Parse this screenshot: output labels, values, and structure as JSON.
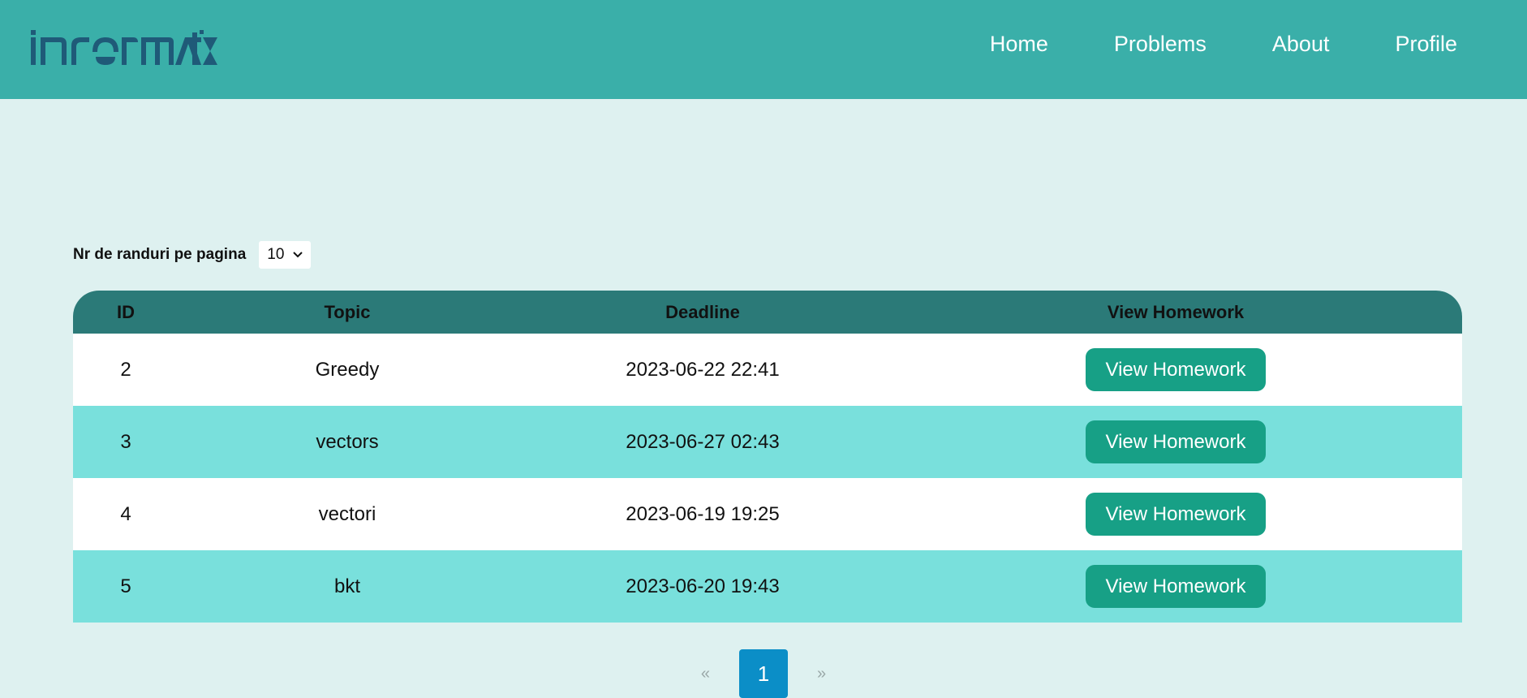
{
  "brand": {
    "logo_text": "informatix",
    "logo_color": "#1f5a78"
  },
  "nav": {
    "items": [
      {
        "label": "Home"
      },
      {
        "label": "Problems"
      },
      {
        "label": "About"
      },
      {
        "label": "Profile"
      }
    ]
  },
  "controls": {
    "rows_label": "Nr de randuri pe pagina",
    "rows_value": "10"
  },
  "table": {
    "headers": [
      "ID",
      "Topic",
      "Deadline",
      "View Homework"
    ],
    "rows": [
      {
        "id": "2",
        "topic": "Greedy",
        "deadline": "2023-06-22 22:41",
        "button": "View Homework"
      },
      {
        "id": "3",
        "topic": "vectors",
        "deadline": "2023-06-27 02:43",
        "button": "View Homework"
      },
      {
        "id": "4",
        "topic": "vectori",
        "deadline": "2023-06-19 19:25",
        "button": "View Homework"
      },
      {
        "id": "5",
        "topic": "bkt",
        "deadline": "2023-06-20 19:43",
        "button": "View Homework"
      }
    ]
  },
  "pagination": {
    "prev": "«",
    "current": "1",
    "next": "»"
  },
  "colors": {
    "navbar": "#3aafa9",
    "page_bg": "#def1f0",
    "table_header": "#2b7a78",
    "row_alt": "#79e0dc",
    "button": "#17a086",
    "page_active": "#0b8ec7"
  }
}
